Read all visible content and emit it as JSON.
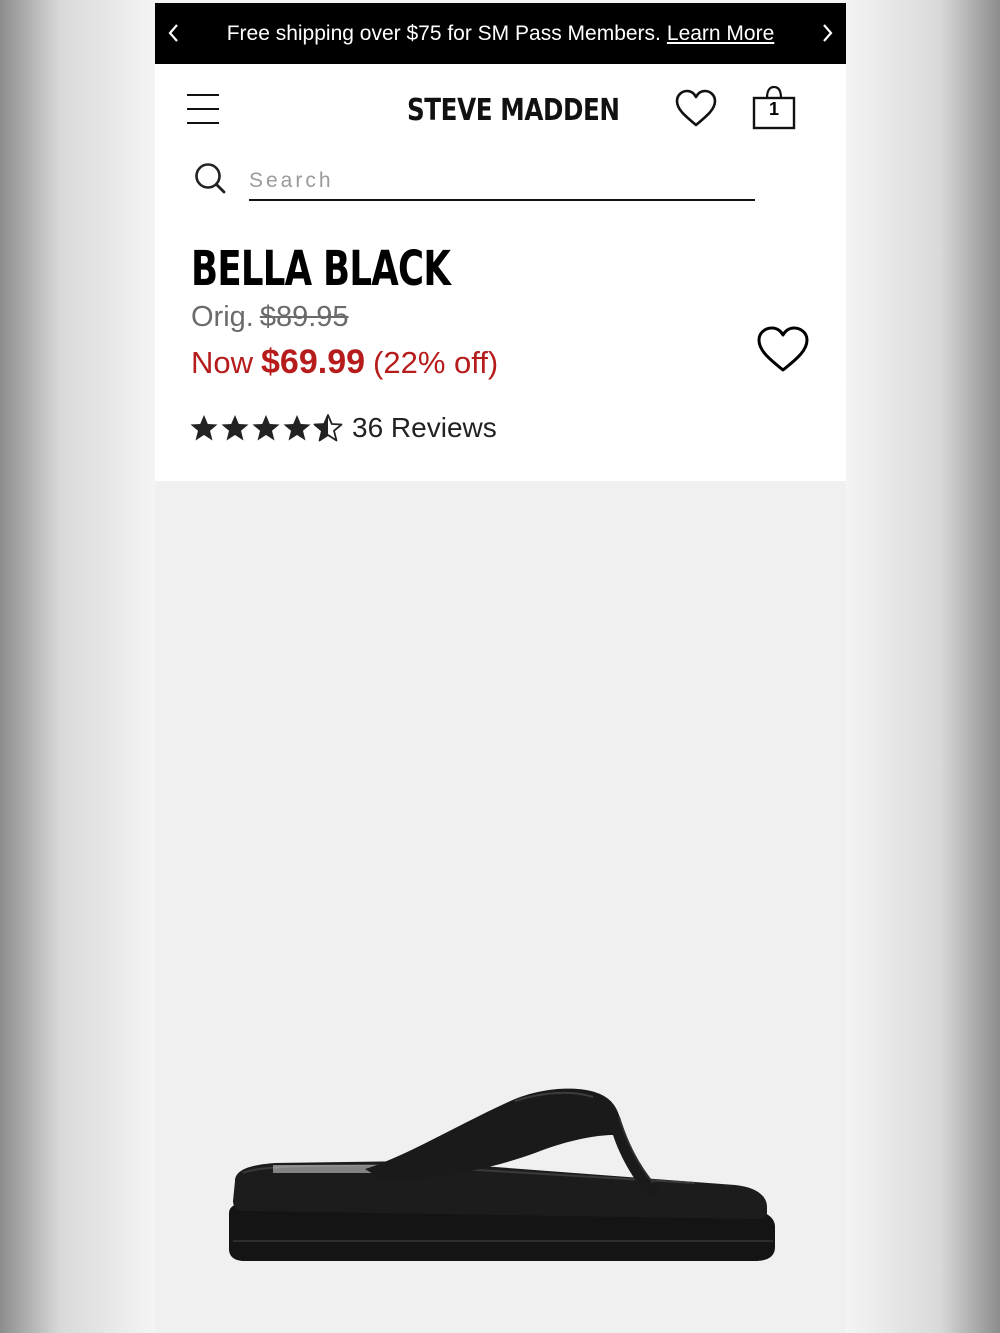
{
  "promo": {
    "message": "Free shipping over $75 for SM Pass Members.",
    "link_label": "Learn More",
    "prev_icon": "chevron-left-icon",
    "next_icon": "chevron-right-icon"
  },
  "header": {
    "menu_icon": "hamburger-menu-icon",
    "logo_text": "STEVE MADDEN",
    "wishlist_icon": "heart-icon",
    "bag_icon": "shopping-bag-icon",
    "bag_count": "1"
  },
  "search": {
    "placeholder": "Search",
    "value": "",
    "icon": "search-icon"
  },
  "product": {
    "name": "BELLA BLACK",
    "orig_label": "Orig.",
    "orig_price": "$89.95",
    "now_label": "Now",
    "now_price": "$69.99",
    "discount": "(22% off)",
    "rating": 4.5,
    "rating_max": 5,
    "reviews_label": "36 Reviews",
    "wishlist_icon": "heart-icon"
  },
  "colors": {
    "sale_red": "#b71c1c",
    "text_black": "#000000",
    "muted_gray": "#6b6b6b",
    "gallery_bg": "#f0f0f0"
  }
}
